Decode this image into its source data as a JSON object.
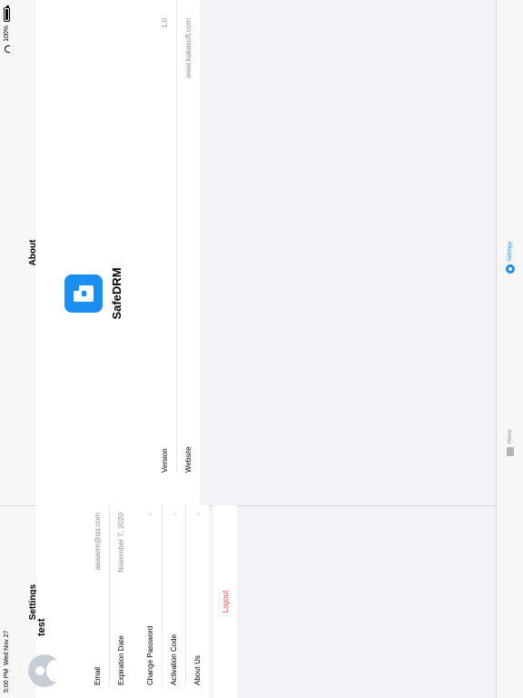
{
  "status_bar": {
    "time": "5:00 PM",
    "date": "Wed Nov 27",
    "battery": "100%"
  },
  "left": {
    "title": "Settings",
    "user": {
      "name": "test",
      "email_label": "Email",
      "email_value": "aaaaem@qq.com",
      "exp_label": "Expiration Date",
      "exp_value": "November 7, 2020"
    },
    "menu": [
      {
        "label": "Change Password"
      },
      {
        "label": "Activation Code"
      },
      {
        "label": "About Us"
      }
    ],
    "logout": "Logout"
  },
  "about": {
    "title": "About",
    "app_name": "SafeDRM",
    "rows": [
      {
        "label": "Version",
        "value": "1.0"
      },
      {
        "label": "Website",
        "value": "www.kakasoft.com"
      }
    ]
  },
  "tabbar": {
    "home": "Home",
    "settings": "Settings"
  },
  "colors": {
    "accent": "#1a8ef1",
    "logout": "#ff3b30"
  }
}
